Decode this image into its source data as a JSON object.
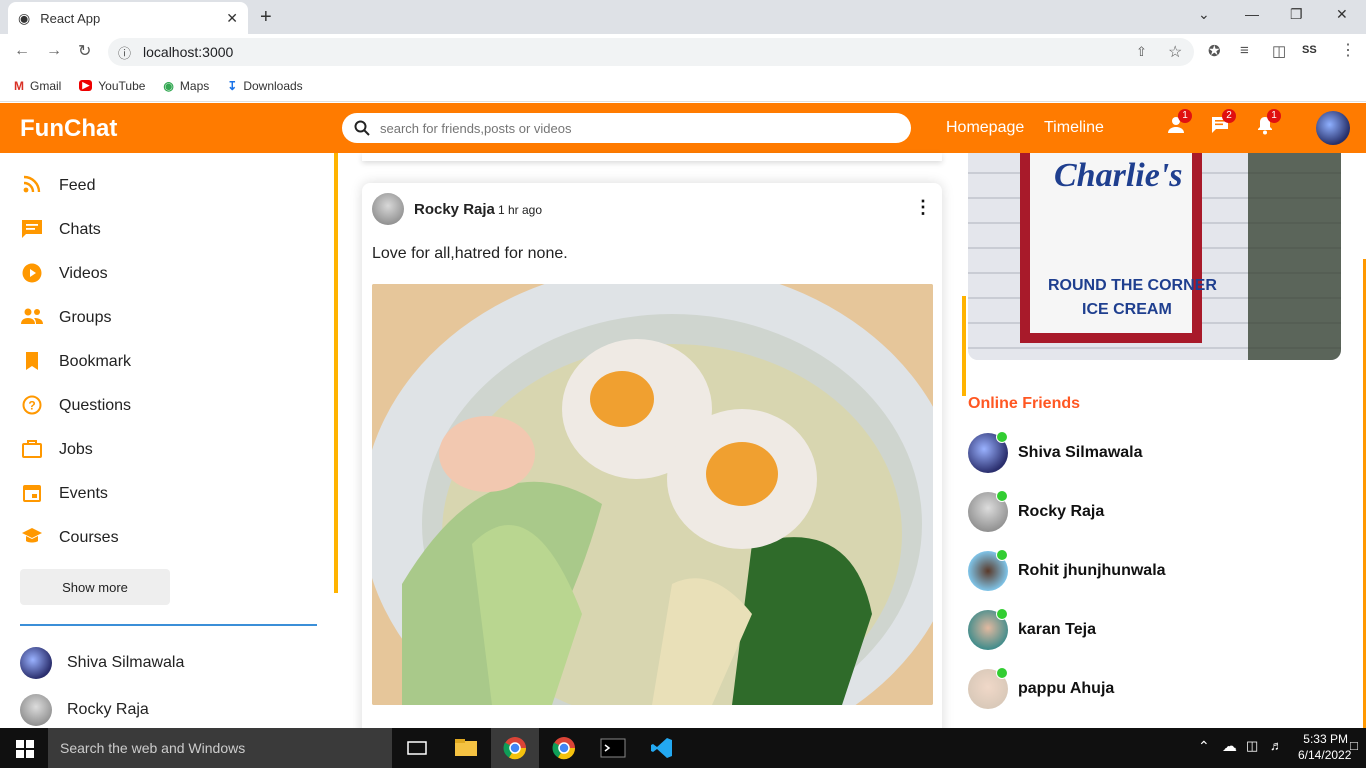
{
  "browser": {
    "tab_title": "React App",
    "url": "localhost:3000",
    "bookmarks": [
      {
        "label": "Gmail"
      },
      {
        "label": "YouTube"
      },
      {
        "label": "Maps"
      },
      {
        "label": "Downloads"
      }
    ]
  },
  "topbar": {
    "logo": "FunChat",
    "search_placeholder": "search for friends,posts or videos",
    "links": [
      "Homepage",
      "Timeline"
    ],
    "badges": {
      "person": "1",
      "chat": "2",
      "notifications": "1"
    }
  },
  "sidebar": {
    "items": [
      {
        "label": "Feed",
        "icon": "rss-icon"
      },
      {
        "label": "Chats",
        "icon": "chat-icon"
      },
      {
        "label": "Videos",
        "icon": "play-circle-icon"
      },
      {
        "label": "Groups",
        "icon": "group-icon"
      },
      {
        "label": "Bookmark",
        "icon": "bookmark-icon"
      },
      {
        "label": "Questions",
        "icon": "help-circle-icon"
      },
      {
        "label": "Jobs",
        "icon": "briefcase-icon"
      },
      {
        "label": "Events",
        "icon": "calendar-icon"
      },
      {
        "label": "Courses",
        "icon": "school-icon"
      }
    ],
    "show_more": "Show more",
    "friends": [
      "Shiva Silmawala",
      "Rocky Raja"
    ]
  },
  "post": {
    "author": "Rocky Raja",
    "time": "1 hr ago",
    "text": "Love for all,hatred for none."
  },
  "rightbar": {
    "ad_sign_line1": "Charlie's",
    "ad_sign_line2": "ROUND THE CORNER",
    "ad_sign_line3": "ICE CREAM",
    "online_title": "Online Friends",
    "online_friends": [
      "Shiva Silmawala",
      "Rocky Raja",
      "Rohit jhunjhunwala",
      "karan Teja",
      "pappu Ahuja"
    ]
  },
  "taskbar": {
    "search_placeholder": "Search the web and Windows",
    "time": "5:33 PM",
    "date": "6/14/2022"
  },
  "colors": {
    "accent": "#ff7b00",
    "icon": "#ff9800",
    "online_title": "#ff5722",
    "online_dot": "#32cd32"
  }
}
